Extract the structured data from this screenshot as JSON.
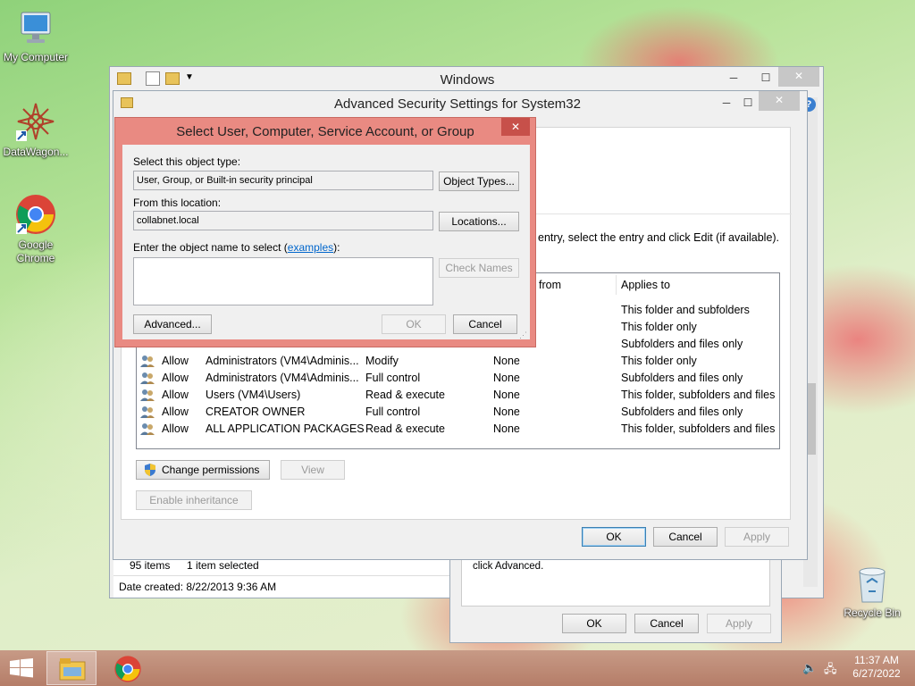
{
  "desktop": {
    "icons": [
      {
        "label": "My Computer"
      },
      {
        "label": "DataWagon..."
      },
      {
        "label": "Google Chrome"
      },
      {
        "label": "Recycle Bin"
      }
    ]
  },
  "explorer": {
    "title": "Windows",
    "status_items": "95 items",
    "status_selected": "1 item selected",
    "date_created": "Date created: 8/22/2013 9:36 AM"
  },
  "advanced": {
    "title": "Advanced Security Settings for System32",
    "instruction": "entry, select the entry and click Edit (if available).",
    "columns": {
      "inherited": "from",
      "applies": "Applies to"
    },
    "rows": [
      {
        "type": "",
        "principal": "",
        "access": "",
        "inherited": "",
        "applies": "This folder and subfolders"
      },
      {
        "type": "",
        "principal": "",
        "access": "",
        "inherited": "",
        "applies": "This folder only"
      },
      {
        "type": "",
        "principal": "",
        "access": "",
        "inherited": "",
        "applies": "Subfolders and files only"
      },
      {
        "type": "Allow",
        "principal": "Administrators (VM4\\Adminis...",
        "access": "Modify",
        "inherited": "None",
        "applies": "This folder only"
      },
      {
        "type": "Allow",
        "principal": "Administrators (VM4\\Adminis...",
        "access": "Full control",
        "inherited": "None",
        "applies": "Subfolders and files only"
      },
      {
        "type": "Allow",
        "principal": "Users (VM4\\Users)",
        "access": "Read & execute",
        "inherited": "None",
        "applies": "This folder, subfolders and files"
      },
      {
        "type": "Allow",
        "principal": "CREATOR OWNER",
        "access": "Full control",
        "inherited": "None",
        "applies": "Subfolders and files only"
      },
      {
        "type": "Allow",
        "principal": "ALL APPLICATION PACKAGES",
        "access": "Read & execute",
        "inherited": "None",
        "applies": "This folder, subfolders and files"
      }
    ],
    "change_permissions": "Change permissions",
    "view": "View",
    "enable_inheritance": "Enable inheritance",
    "ok": "OK",
    "cancel": "Cancel",
    "apply": "Apply"
  },
  "properties": {
    "advanced_hint": "click Advanced.",
    "ok": "OK",
    "cancel": "Cancel",
    "apply": "Apply"
  },
  "dialog": {
    "title": "Select User, Computer, Service Account, or Group",
    "object_type_label": "Select this object type:",
    "object_type_value": "User, Group, or Built-in security principal",
    "object_types_button": "Object Types...",
    "location_label": "From this location:",
    "location_value": "collabnet.local",
    "locations_button": "Locations...",
    "name_label_prefix": "Enter the object name to select (",
    "name_label_link": "examples",
    "name_label_suffix": "):",
    "name_value": "",
    "check_names": "Check Names",
    "advanced": "Advanced...",
    "ok": "OK",
    "cancel": "Cancel"
  },
  "taskbar": {
    "time": "11:37 AM",
    "date": "6/27/2022"
  },
  "colors": {
    "dialog_frame": "#e98a82",
    "close_red": "#c7504a",
    "taskbar": "#b98672",
    "link": "#0066cc"
  }
}
